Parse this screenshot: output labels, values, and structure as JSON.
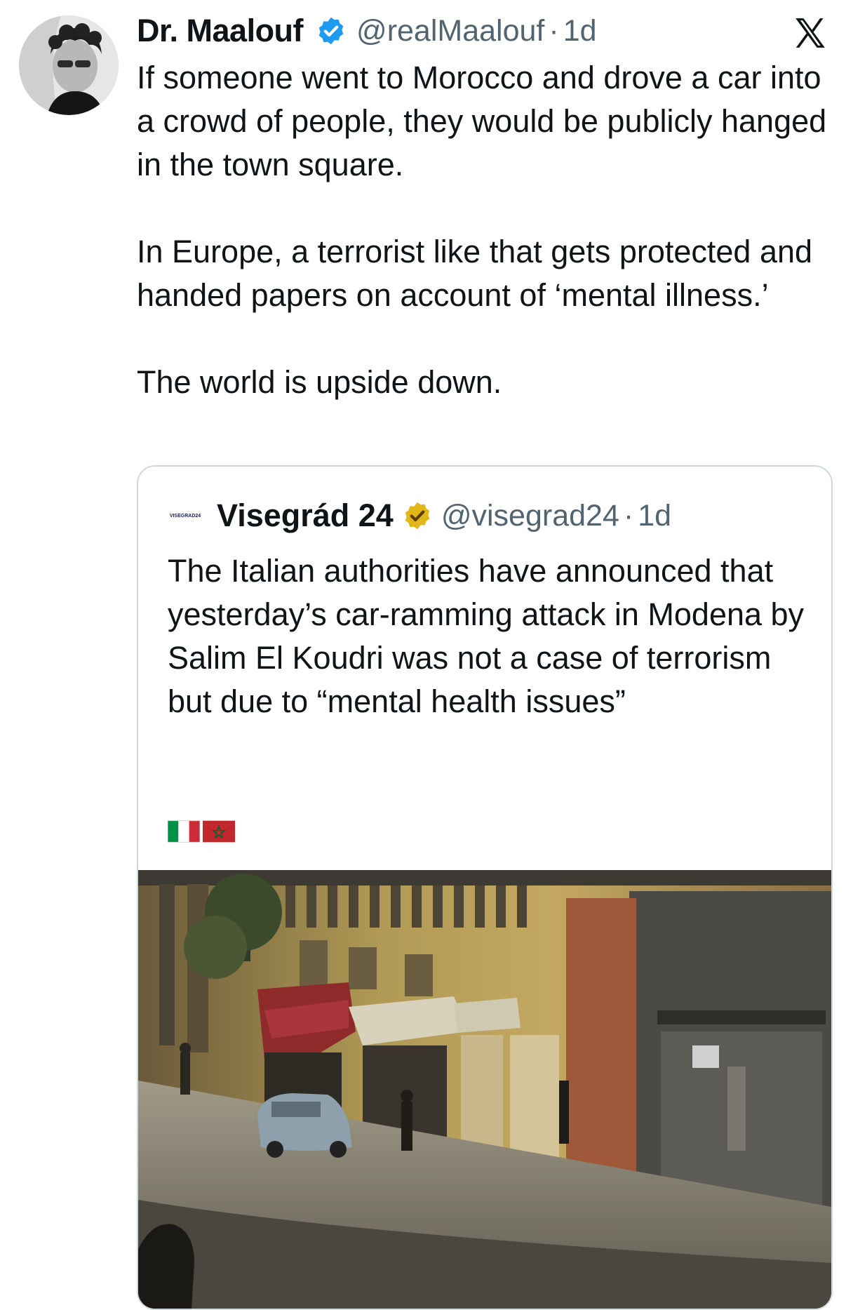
{
  "post": {
    "display_name": "Dr. Maalouf",
    "handle": "@realMaalouf",
    "separator": "·",
    "time": "1d",
    "paragraphs": [
      "If someone went to Morocco and drove a car into a crowd of people, they would be publicly hanged in the town square.",
      "In Europe, a terrorist like that gets protected and handed papers on account of ‘mental illness.’",
      "The world is upside down."
    ],
    "verified_icon": "blue-check-icon",
    "platform_logo_icon": "x-logo-icon"
  },
  "quoted": {
    "avatar_text": "VISEGRAD24",
    "display_name": "Visegrád 24",
    "handle": "@visegrad24",
    "separator": "·",
    "time": "1d",
    "text": "The Italian authorities have announced that yesterday’s car-ramming attack in Modena by Salim El Koudri was not a case of terrorism but due to “mental health issues”",
    "badge_icon": "gold-check-icon",
    "flags": [
      "italy-flag-icon",
      "morocco-flag-icon"
    ]
  },
  "colors": {
    "text_primary": "#0f1419",
    "text_secondary": "#536471",
    "verified_blue": "#1d9bf0",
    "verified_gold": "#e2b719",
    "border": "#cfd9de"
  }
}
